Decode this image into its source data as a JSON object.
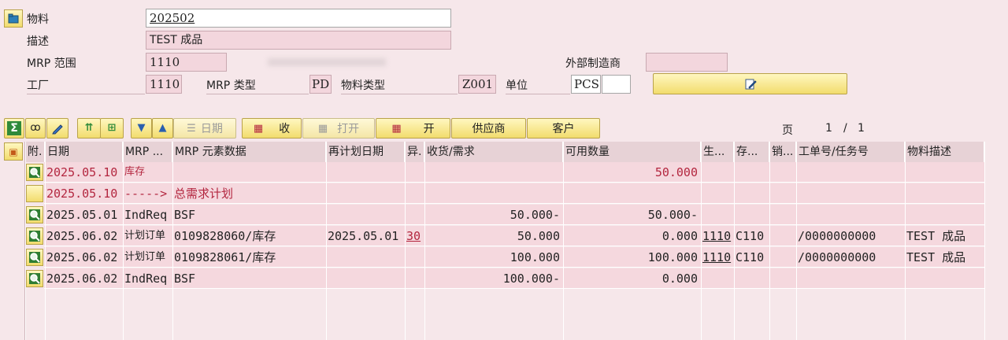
{
  "header": {
    "material_label": "物料",
    "material_value": "202502",
    "desc_label": "描述",
    "desc_value": "TEST 成品",
    "mrp_area_label": "MRP 范围",
    "mrp_area_value": "1110",
    "ext_mfr_label": "外部制造商",
    "ext_mfr_value": "",
    "plant_label": "工厂",
    "plant_value": "1110",
    "mrp_type_label": "MRP 类型",
    "mrp_type_value": "PD",
    "mat_type_label": "物料类型",
    "mat_type_value": "Z001",
    "unit_label": "单位",
    "unit_value": "PCS"
  },
  "toolbar": {
    "date_label": "日期",
    "receive_label": "收",
    "open_label": "打开",
    "open2_label": "开",
    "supplier_label": "供应商",
    "customer_label": "客户",
    "page_label": "页",
    "page_current": "1",
    "page_sep": "/",
    "page_total": "1"
  },
  "columns": [
    "附.",
    "日期",
    "MRP ...",
    "MRP 元素数据",
    "再计划日期",
    "异.",
    "收货/需求",
    "可用数量",
    "生...",
    "存...",
    "销...",
    "工单号/任务号",
    "物料描述"
  ],
  "rows": [
    {
      "date": "2025.05.10",
      "mrp": "库存",
      "element": "",
      "resched": "",
      "exc": "",
      "recv": "",
      "avail": "50.000",
      "prod": "",
      "stor": "",
      "sales": "",
      "order": "",
      "desc": "",
      "style": "red",
      "icon": "magnifier-icon"
    },
    {
      "date": "2025.05.10",
      "mrp": "----->",
      "element": "总需求计划",
      "resched": "",
      "exc": "",
      "recv": "",
      "avail": "",
      "prod": "",
      "stor": "",
      "sales": "",
      "order": "",
      "desc": "",
      "style": "red",
      "icon": ""
    },
    {
      "date": "2025.05.01",
      "mrp": "IndReq",
      "element": "BSF",
      "resched": "",
      "exc": "",
      "recv": "50.000-",
      "avail": "50.000-",
      "prod": "",
      "stor": "",
      "sales": "",
      "order": "",
      "desc": "",
      "style": "normal",
      "icon": "magnifier-icon"
    },
    {
      "date": "2025.06.02",
      "mrp": "计划订单",
      "element": "0109828060/库存",
      "resched": "2025.05.01",
      "exc": "30",
      "recv": "50.000",
      "avail": "0.000",
      "prod": "1110",
      "stor": "C110",
      "sales": "",
      "order": "/0000000000",
      "desc": "TEST 成品",
      "style": "normal",
      "icon": "magnifier-icon"
    },
    {
      "date": "2025.06.02",
      "mrp": "计划订单",
      "element": "0109828061/库存",
      "resched": "",
      "exc": "",
      "recv": "100.000",
      "avail": "100.000",
      "prod": "1110",
      "stor": "C110",
      "sales": "",
      "order": "/0000000000",
      "desc": "TEST 成品",
      "style": "normal",
      "icon": "magnifier-icon"
    },
    {
      "date": "2025.06.02",
      "mrp": "IndReq",
      "element": "BSF",
      "resched": "",
      "exc": "",
      "recv": "100.000-",
      "avail": "0.000",
      "prod": "",
      "stor": "",
      "sales": "",
      "order": "",
      "desc": "",
      "style": "normal",
      "icon": "magnifier-icon"
    }
  ],
  "colors": {
    "background": "#f6e7ea",
    "field": "#f3d6dd",
    "button": "#f2dc6d",
    "accent_red": "#b3263f"
  }
}
